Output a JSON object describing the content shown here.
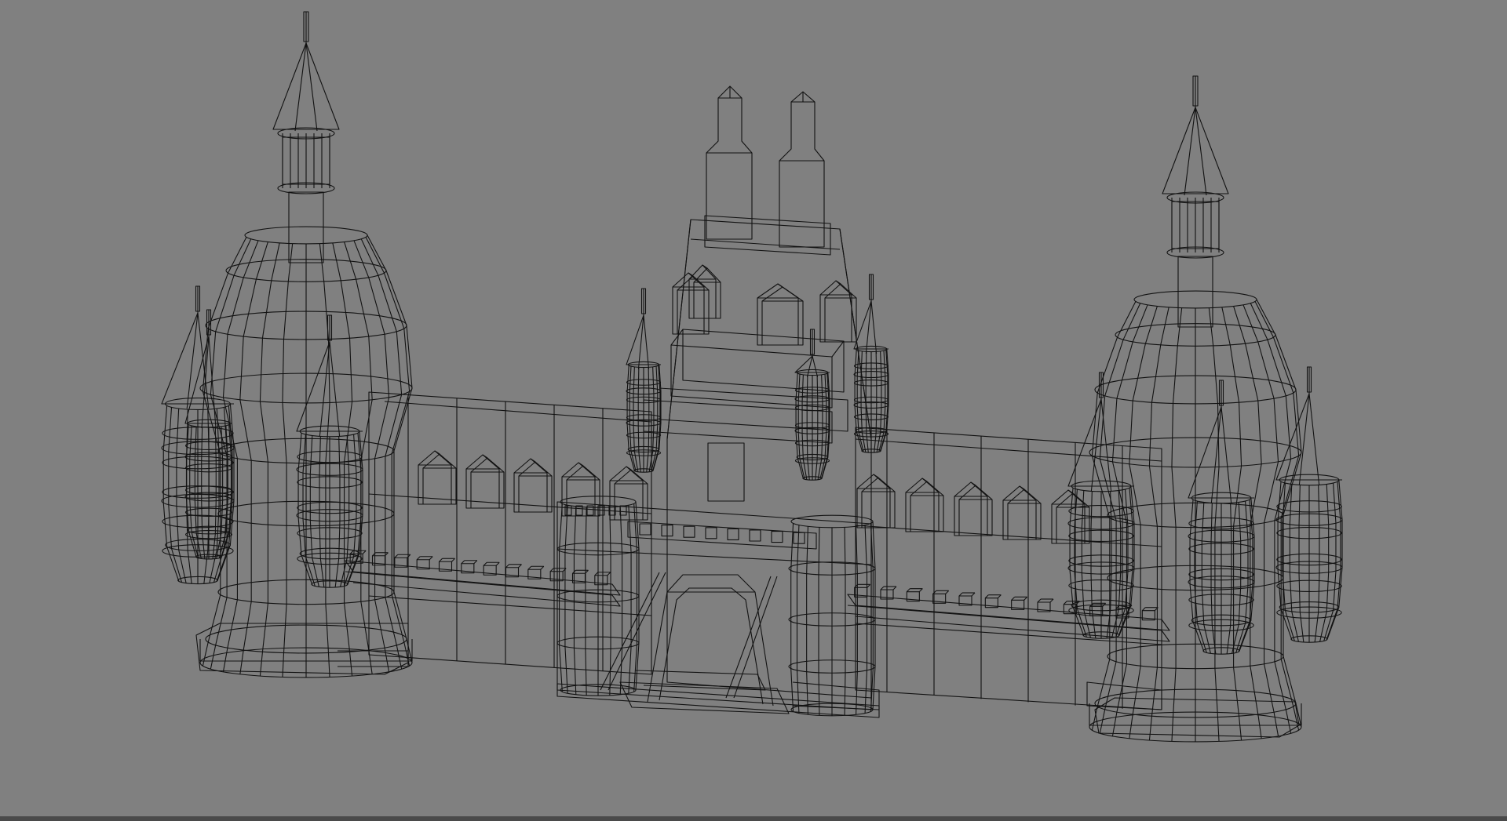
{
  "viewport": {
    "background": "#808080",
    "line_color": "#121212",
    "render_mode": "wireframe",
    "subject": "castle-model"
  }
}
